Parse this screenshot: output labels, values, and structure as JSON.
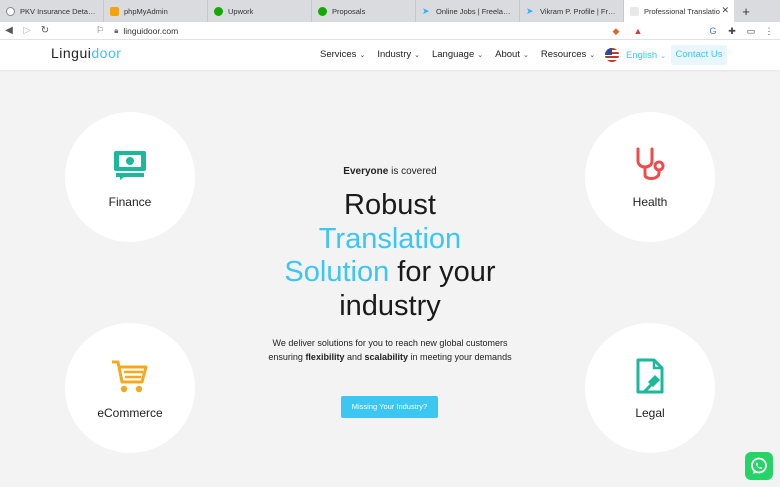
{
  "browser": {
    "tabs": [
      {
        "title": "PKV Insurance Details | Ad",
        "favicon": "globe-icon"
      },
      {
        "title": "phpMyAdmin",
        "favicon": "phpmyadmin-icon"
      },
      {
        "title": "Upwork",
        "favicon": "upwork-icon"
      },
      {
        "title": "Proposals",
        "favicon": "upwork-icon"
      },
      {
        "title": "Online Jobs | Freelance Em",
        "favicon": "freelancer-icon"
      },
      {
        "title": "Vikram P. Profile | Freelan",
        "favicon": "freelancer-icon"
      },
      {
        "title": "Professional Translatio",
        "favicon": "page-icon",
        "active": true
      }
    ],
    "url": "linguidoor.com"
  },
  "site": {
    "logo": {
      "part1": "Lingui",
      "part2": "door"
    },
    "nav": [
      "Services",
      "Industry",
      "Language",
      "About",
      "Resources"
    ],
    "language": "English",
    "contact": "Contact Us"
  },
  "hero": {
    "covered_bold": "Everyone",
    "covered_rest": " is covered",
    "headline": {
      "l1": "Robust",
      "l2": "Translation",
      "l3a": "Solution",
      "l3b": " for your",
      "l4": "industry"
    },
    "sub": {
      "line1": "We deliver solutions for you to reach new global customers",
      "pre": "ensuring ",
      "b1": "flexibility",
      "mid": " and ",
      "b2": "scalability",
      "post": " in meeting your demands"
    },
    "cta": "Missing Your Industry?"
  },
  "industries": {
    "finance": "Finance",
    "health": "Health",
    "ecommerce": "eCommerce",
    "legal": "Legal"
  },
  "colors": {
    "accent": "#3cc6f2",
    "finance": "#1bb99a",
    "health": "#ef4b4b",
    "ecommerce": "#f4a81d",
    "legal": "#1bb99a",
    "whatsapp": "#25d366"
  }
}
